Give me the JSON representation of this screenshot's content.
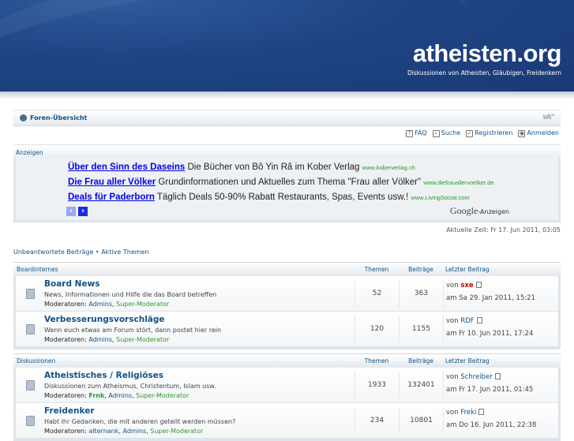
{
  "header": {
    "title": "atheisten.org",
    "description": "Diskussionen von Atheisten, Gläubigen, Freidenkern"
  },
  "nav": {
    "breadcrumb": "Foren-Übersicht",
    "resize": "∨A^"
  },
  "userlinks": [
    {
      "icon": "help-icon",
      "label": "FAQ",
      "glyph": "?"
    },
    {
      "icon": "search-icon",
      "label": "Suche",
      "glyph": "⌕"
    },
    {
      "icon": "register-icon",
      "label": "Registrieren",
      "glyph": "✓"
    },
    {
      "icon": "login-icon",
      "label": "Anmelden",
      "glyph": "◉"
    }
  ],
  "ads": {
    "heading": "Anzeigen",
    "items": [
      {
        "title": "Über den Sinn des Daseins",
        "text": "Die Bücher von Bô Yin Râ im Kober Verlag",
        "url": "www.koberverlag.ch"
      },
      {
        "title": "Die Frau aller Völker",
        "text": "Grundinformationen und Aktuelles zum Thema \"Frau aller Völker\"",
        "url": "www.diefrauallervoelker.de"
      },
      {
        "title": "Deals für Paderborn",
        "text": "Täglich Deals 50-90% Rabatt Restaurants, Spas, Events usw.!",
        "url": "www.LivingSocial.com"
      }
    ],
    "prev": "‹",
    "next": "›",
    "google": "Google",
    "google_suffix": "-Anzeigen"
  },
  "time": "Aktuelle Zeit: Fr 17. Jun 2011, 03:05",
  "quicklinks": {
    "unanswered": "Unbeantwortete Beiträge",
    "sep": " • ",
    "active": "Aktive Themen"
  },
  "columns": {
    "topics": "Themen",
    "posts": "Beiträge",
    "last": "Letzter Beitrag"
  },
  "categories": [
    {
      "name": "Boardinternes",
      "forums": [
        {
          "name": "Board News",
          "desc": "News, Informationen und Hilfe die das Board betreffen",
          "mod_label": "Moderatoren:",
          "mods": [
            {
              "n": "Admins",
              "c": ""
            },
            {
              "n": "Super-Moderator",
              "c": "g"
            }
          ],
          "topics": "52",
          "posts": "363",
          "by_label": "von",
          "by": "sxe",
          "by_red": true,
          "date": "am Sa 29. Jan 2011, 15:21"
        },
        {
          "name": "Verbesserungsvorschläge",
          "desc": "Wenn euch etwas am Forum stört, dann postet hier rein",
          "mod_label": "Moderatoren:",
          "mods": [
            {
              "n": "Admins",
              "c": ""
            },
            {
              "n": "Super-Moderator",
              "c": "g"
            }
          ],
          "topics": "120",
          "posts": "1155",
          "by_label": "von",
          "by": "RDF",
          "by_red": false,
          "date": "am Fr 10. Jun 2011, 17:24"
        }
      ]
    },
    {
      "name": "Diskussionen",
      "forums": [
        {
          "name": "Atheistisches / Religiöses",
          "desc": "Diskussionen zum Atheismus, Christentum, Islam usw.",
          "mod_label": "Moderatoren:",
          "mods": [
            {
              "n": "Frnk",
              "c": "gb"
            },
            {
              "n": "Admins",
              "c": ""
            },
            {
              "n": "Super-Moderator",
              "c": "g"
            }
          ],
          "topics": "1933",
          "posts": "132401",
          "by_label": "von",
          "by": "Schreiber",
          "by_red": false,
          "date": "am Fr 17. Jun 2011, 01:45"
        },
        {
          "name": "Freidenker",
          "desc": "Habt ihr Gedanken, die mit anderen geteilt werden müssen?",
          "mod_label": "Moderatoren:",
          "mods": [
            {
              "n": "alternank",
              "c": ""
            },
            {
              "n": "Admins",
              "c": ""
            },
            {
              "n": "Super-Moderator",
              "c": "g"
            }
          ],
          "topics": "234",
          "posts": "10801",
          "by_label": "von",
          "by": "Freki",
          "by_red": false,
          "date": "am Do 16. Jun 2011, 22:38"
        }
      ]
    }
  ]
}
